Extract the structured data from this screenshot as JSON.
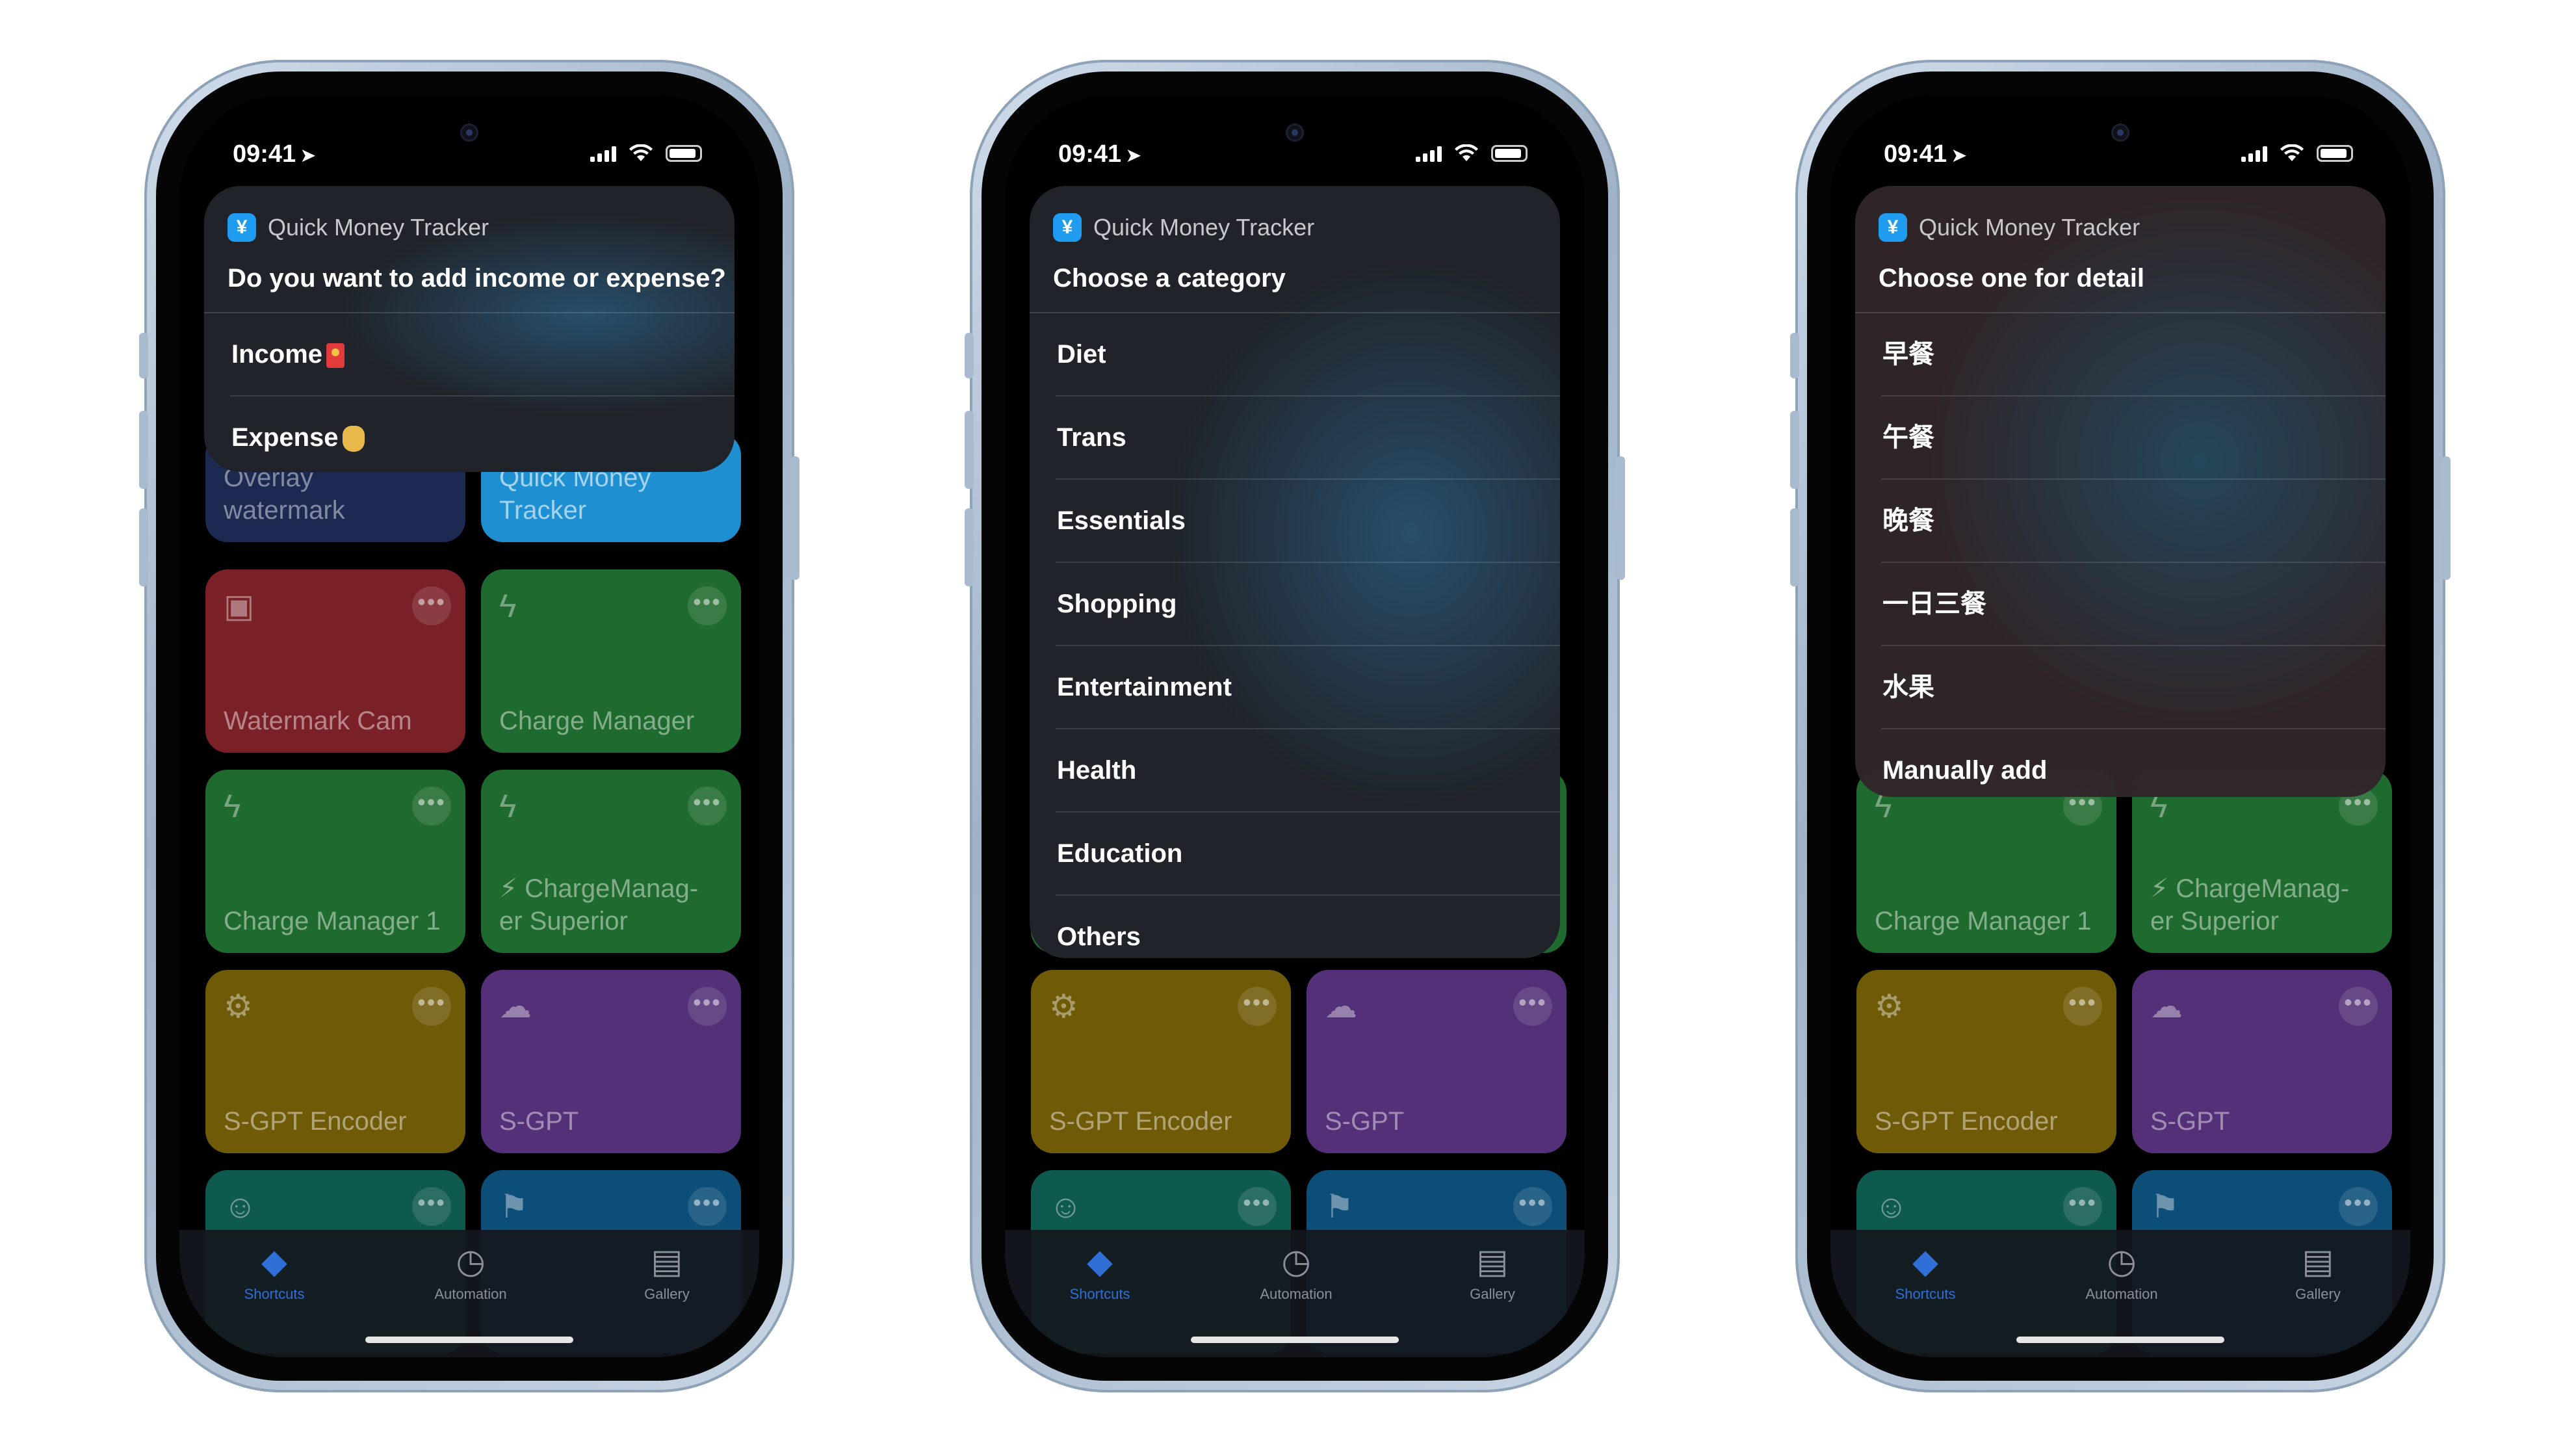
{
  "phones": [
    {
      "status": {
        "time": "09:41"
      },
      "prompt": {
        "app_name": "Quick Money Tracker",
        "question": "Do you want to add income or expense?",
        "options": [
          "Income",
          "Expense"
        ]
      }
    },
    {
      "status": {
        "time": "09:41"
      },
      "prompt": {
        "app_name": "Quick Money Tracker",
        "question": "Choose a category",
        "options": [
          "Diet",
          "Trans",
          "Essentials",
          "Shopping",
          "Entertainment",
          "Health",
          "Education",
          "Others"
        ]
      }
    },
    {
      "status": {
        "time": "09:41"
      },
      "prompt": {
        "app_name": "Quick Money Tracker",
        "question": "Choose one for detail",
        "options": [
          "早餐",
          "午餐",
          "晚餐",
          "一日三餐",
          "水果",
          "Manually add"
        ]
      }
    }
  ],
  "shortcuts": {
    "overlay_watermark": "Overlay watermark",
    "quick_money_tracker": "Quick Money Tracker",
    "watermark_cam": "Watermark Cam",
    "charge_manager": "Charge Manager",
    "charge_manager_1": "Charge Manager 1",
    "charge_manager_superior": "⚡ ChargeManag-er Superior",
    "sgpt_encoder": "S-GPT Encoder",
    "sgpt": "S-GPT"
  },
  "tabbar": {
    "shortcuts": "Shortcuts",
    "automation": "Automation",
    "gallery": "Gallery"
  },
  "colors": {
    "accent": "#2f6fd6",
    "tile_navy": "#1c2a52",
    "tile_blue": "#1e8fd0",
    "tile_red": "#7a2128",
    "tile_green": "#1f6a2e",
    "tile_olive": "#6f5a08",
    "tile_purple": "#533077",
    "tile_teal": "#0f5a4e",
    "tile_darkblue": "#0d4e78"
  }
}
